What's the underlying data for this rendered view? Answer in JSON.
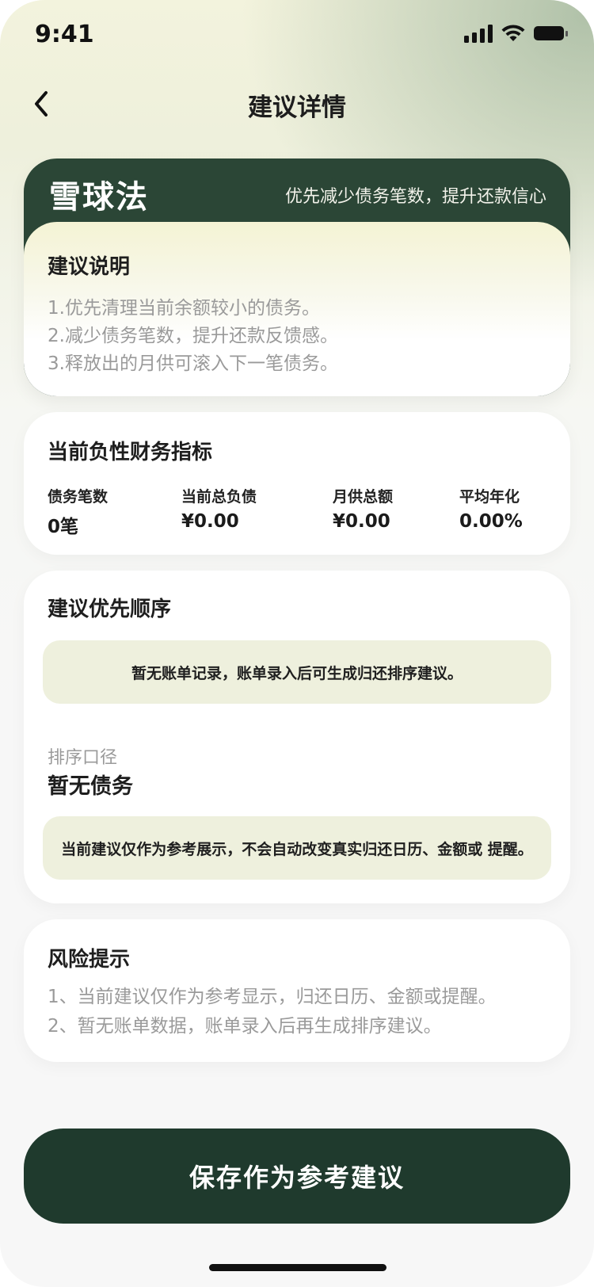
{
  "status_bar": {
    "time": "9:41"
  },
  "nav": {
    "title": "建议详情"
  },
  "strategy": {
    "name": "雪球法",
    "description": "优先减少债务笔数，提升还款信心",
    "section_title": "建议说明",
    "tips": [
      "1.优先清理当前余额较小的债务。",
      "2.减少债务笔数，提升还款反馈感。",
      "3.释放出的月供可滚入下一笔债务。"
    ]
  },
  "metrics": {
    "title": "当前负性财务指标",
    "items": [
      {
        "label": "债务笔数",
        "value": "0笔"
      },
      {
        "label": "当前总负债",
        "value": "¥0.00"
      },
      {
        "label": "月供总额",
        "value": "¥0.00"
      },
      {
        "label": "平均年化",
        "value": "0.00%"
      }
    ]
  },
  "priority": {
    "title": "建议优先顺序",
    "empty_notice": "暂无账单记录，账单录入后可生成归还排序建议。",
    "sort_label": "排序口径",
    "sort_value": "暂无债务",
    "reference_notice": "当前建议仅作为参考展示，不会自动改变真实归还日历、金额或 提醒。"
  },
  "risk": {
    "title": "风险提示",
    "items": [
      "1、当前建议仅作为参考显示，归还日历、金额或提醒。",
      "2、暂无账单数据，账单录入后再生成排序建议。"
    ]
  },
  "actions": {
    "save_label": "保存作为参考建议"
  },
  "colors": {
    "primary_dark_green": "#1f3a2d",
    "header_green": "#2b4636",
    "notice_background": "#eef0dd",
    "muted_text": "#9a9a9a"
  }
}
